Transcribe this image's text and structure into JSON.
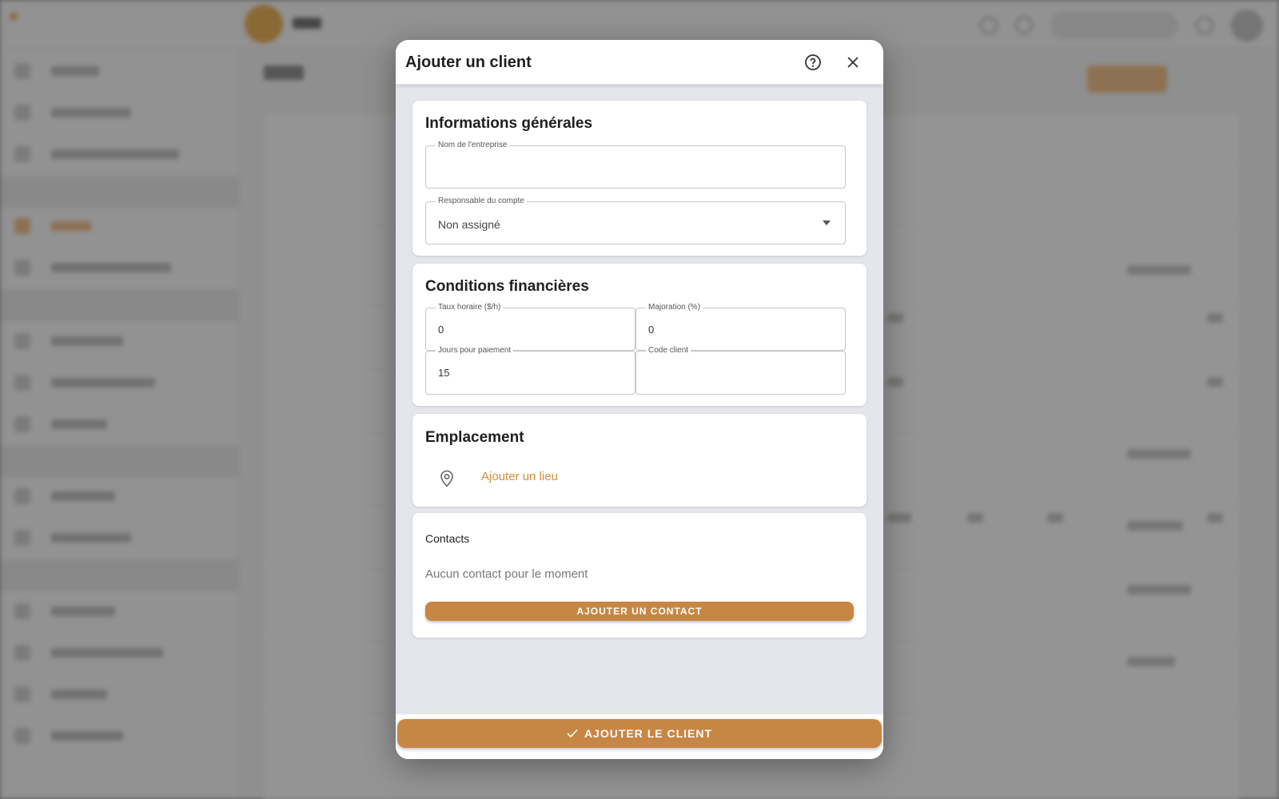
{
  "modal": {
    "title": "Ajouter un client",
    "help_icon": "help-circle-icon",
    "close_icon": "close-icon"
  },
  "general": {
    "title": "Informations générales",
    "company_name": {
      "label": "Nom de l'entreprise",
      "value": ""
    },
    "account_manager": {
      "label": "Responsable du compte",
      "value": "Non assigné"
    }
  },
  "financial": {
    "title": "Conditions financières",
    "hourly_rate": {
      "label": "Taux horaire ($/h)",
      "value": "0"
    },
    "markup": {
      "label": "Majoration (%)",
      "value": "0"
    },
    "payment_days": {
      "label": "Jours pour paiement",
      "value": "15"
    },
    "client_code": {
      "label": "Code client",
      "value": ""
    }
  },
  "location": {
    "title": "Emplacement",
    "icon": "map-pin-icon",
    "add_label": "Ajouter un lieu"
  },
  "contacts": {
    "title": "Contacts",
    "empty_text": "Aucun contact pour le moment",
    "add_button": "AJOUTER UN CONTACT"
  },
  "footer": {
    "submit_label": "AJOUTER LE CLIENT",
    "submit_icon": "check-icon"
  },
  "colors": {
    "accent": "#c88644",
    "link": "#d38b3c"
  }
}
